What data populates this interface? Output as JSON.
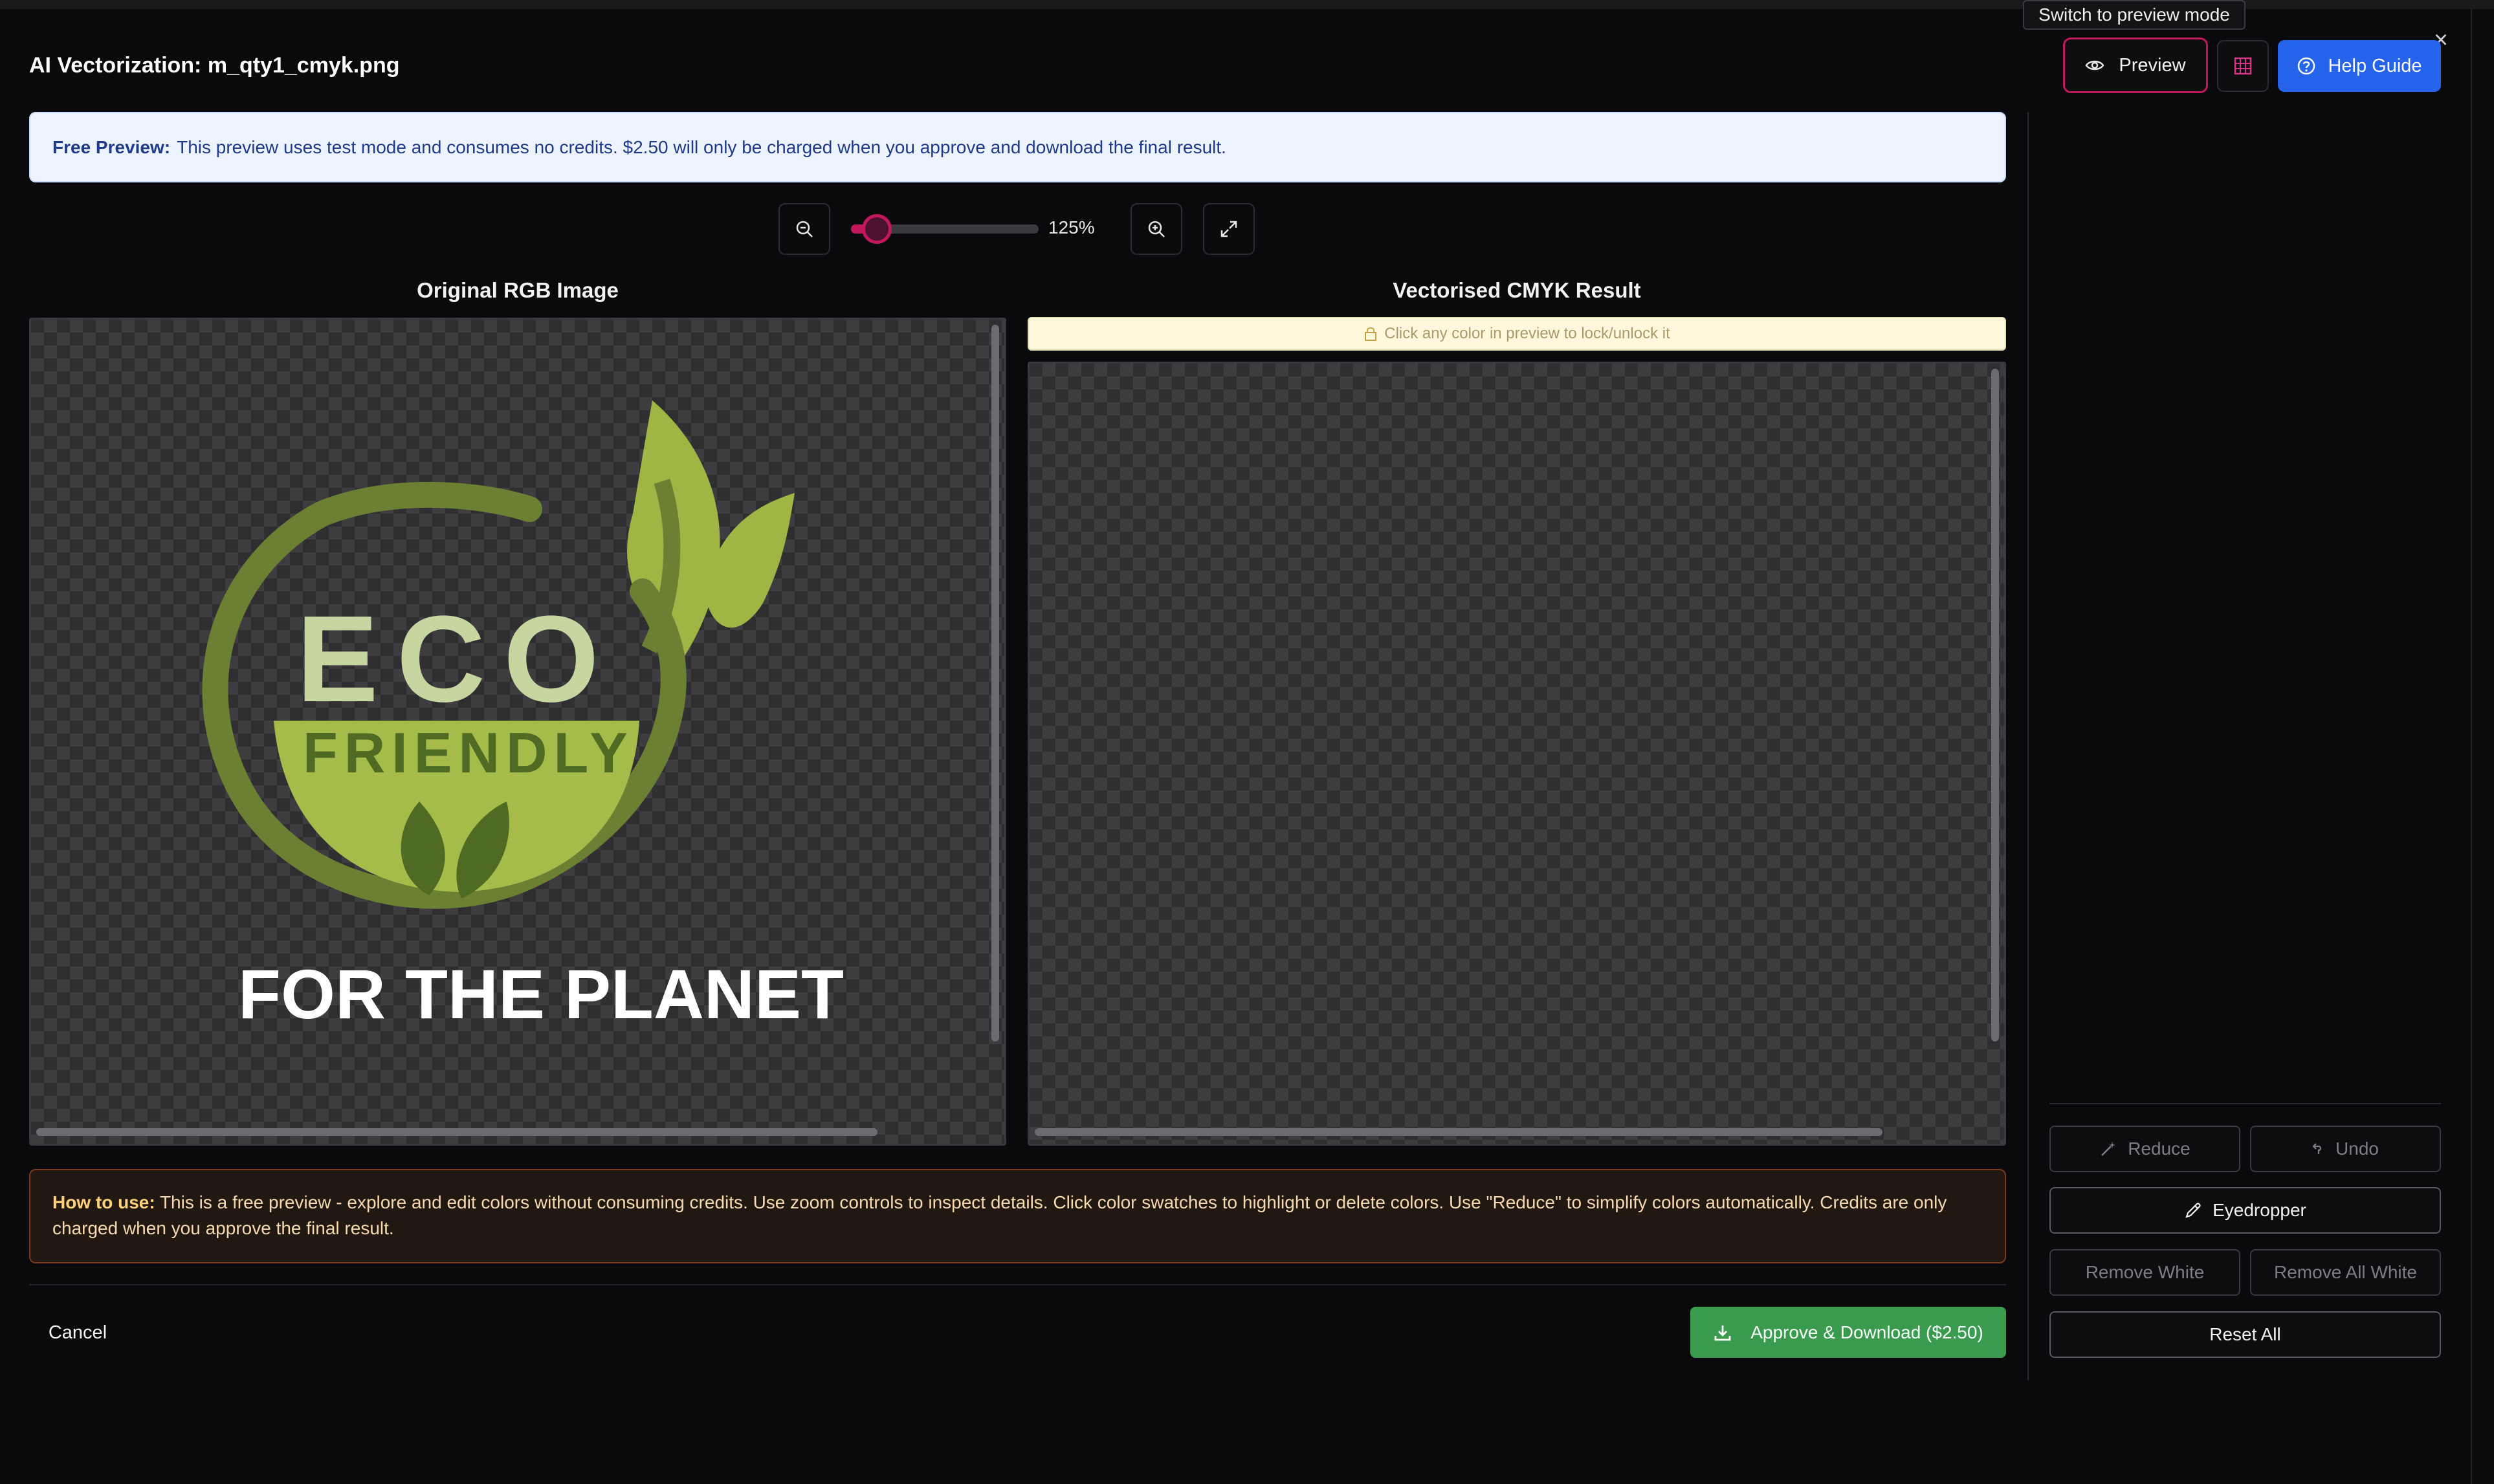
{
  "dialog": {
    "title": "AI Vectorization: m_qty1_cmyk.png",
    "close_icon": "close-icon"
  },
  "toolbar": {
    "tooltip": "Switch to preview mode",
    "preview_label": "Preview",
    "help_label": "Help Guide",
    "icons": [
      "eye-icon",
      "grid-icon",
      "help-circle-icon"
    ],
    "accent_color": "#c2185b",
    "help_color": "#2563eb"
  },
  "banner": {
    "bold": "Free Preview:",
    "text": "This preview uses test mode and consumes no credits. $2.50 will only be charged when you approve and download the final result."
  },
  "zoom": {
    "value_label": "125%",
    "slider_fraction": 0.07,
    "icons": [
      "zoom-out-icon",
      "zoom-in-icon",
      "expand-icon"
    ]
  },
  "original": {
    "title": "Original RGB Image",
    "logo": {
      "word1": "ECO",
      "word2": "FRIENDLY",
      "tagline": "FOR THE PLANET",
      "colors": {
        "dark_green": "#6b8033",
        "light_green": "#a5bb4a",
        "cream": "#c7d6a0"
      }
    }
  },
  "result": {
    "title": "Vectorised CMYK Result",
    "lock_hint": "Click any color in preview to lock/unlock it"
  },
  "help": {
    "bold": "How to use:",
    "line1": "This is a free preview - explore and edit colors without consuming credits. Use zoom controls to inspect details. Click color swatches to highlight or delete colors. Use \"Reduce\" to simplify colors automatically. Credits are only",
    "line2": "charged when you approve the final result."
  },
  "footer": {
    "cancel_label": "Cancel",
    "approve_label": "Approve & Download ($2.50)",
    "approve_color": "#3a9b4f"
  },
  "sidebar": {
    "reduce_label": "Reduce",
    "undo_label": "Undo",
    "eyedropper_label": "Eyedropper",
    "remove_white_label": "Remove White",
    "remove_all_white_label": "Remove All White",
    "reset_all_label": "Reset All"
  }
}
